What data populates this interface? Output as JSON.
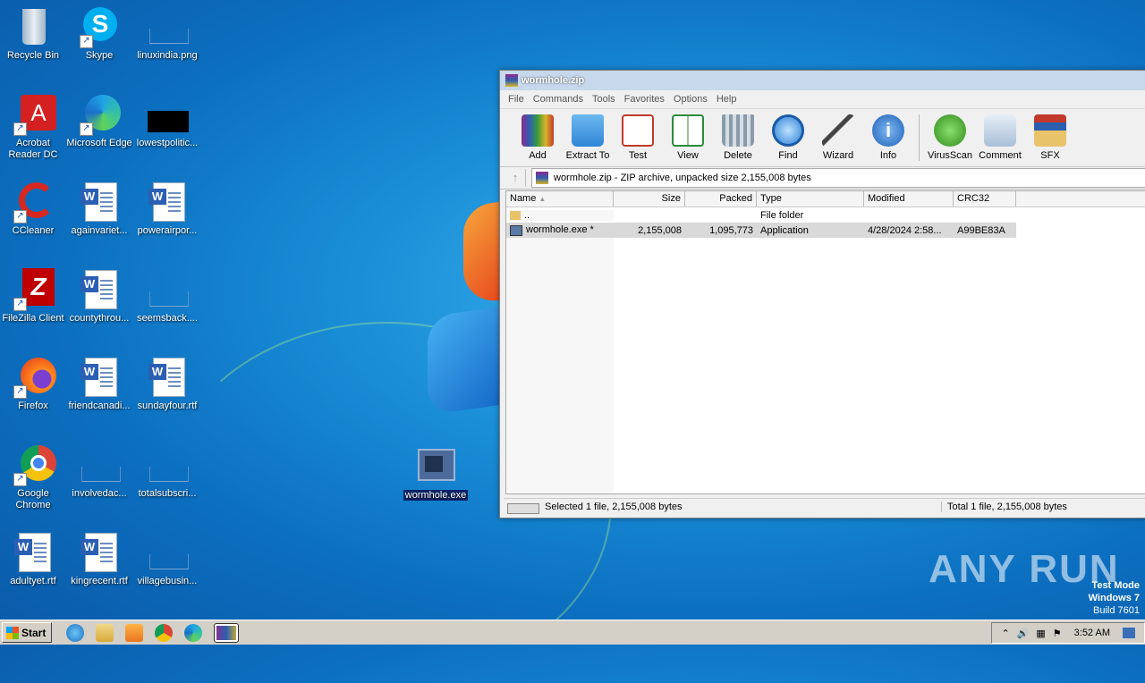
{
  "desktop": {
    "icons": [
      {
        "label": "Recycle Bin",
        "icon": "recycle-bin-icon"
      },
      {
        "label": "Skype",
        "icon": "skype-icon"
      },
      {
        "label": "linuxindia.png",
        "icon": "image-file-icon"
      },
      {
        "label": "Acrobat Reader DC",
        "icon": "acrobat-icon"
      },
      {
        "label": "Microsoft Edge",
        "icon": "edge-icon"
      },
      {
        "label": "lowestpolitic...",
        "icon": "image-file-icon"
      },
      {
        "label": "CCleaner",
        "icon": "ccleaner-icon"
      },
      {
        "label": "againvariet...",
        "icon": "word-doc-icon"
      },
      {
        "label": "powerairpor...",
        "icon": "word-doc-icon"
      },
      {
        "label": "FileZilla Client",
        "icon": "filezilla-icon"
      },
      {
        "label": "countythrou...",
        "icon": "word-doc-icon"
      },
      {
        "label": "seemsback....",
        "icon": "blank-file-icon"
      },
      {
        "label": "Firefox",
        "icon": "firefox-icon"
      },
      {
        "label": "friendcanadi...",
        "icon": "word-doc-icon"
      },
      {
        "label": "sundayfour.rtf",
        "icon": "word-doc-icon"
      },
      {
        "label": "Google Chrome",
        "icon": "chrome-icon"
      },
      {
        "label": "involvedac...",
        "icon": "blank-file-icon"
      },
      {
        "label": "totalsubscri...",
        "icon": "blank-file-icon"
      },
      {
        "label": "adultyet.rtf",
        "icon": "word-doc-icon"
      },
      {
        "label": "kingrecent.rtf",
        "icon": "word-doc-icon"
      },
      {
        "label": "villagebusin...",
        "icon": "blank-file-icon"
      },
      {
        "label": "wormhole.exe",
        "icon": "exe-file-icon"
      }
    ]
  },
  "window": {
    "title": "wormhole.zip",
    "menu": [
      "File",
      "Commands",
      "Tools",
      "Favorites",
      "Options",
      "Help"
    ],
    "toolbar": [
      "Add",
      "Extract To",
      "Test",
      "View",
      "Delete",
      "Find",
      "Wizard",
      "Info",
      "VirusScan",
      "Comment",
      "SFX"
    ],
    "address": "wormhole.zip - ZIP archive, unpacked size 2,155,008 bytes",
    "columns": [
      "Name",
      "Size",
      "Packed",
      "Type",
      "Modified",
      "CRC32"
    ],
    "rows": [
      {
        "name": "..",
        "size": "",
        "packed": "",
        "type": "File folder",
        "modified": "",
        "crc": ""
      },
      {
        "name": "wormhole.exe *",
        "size": "2,155,008",
        "packed": "1,095,773",
        "type": "Application",
        "modified": "4/28/2024 2:58...",
        "crc": "A99BE83A"
      }
    ],
    "status_left": "Selected 1 file, 2,155,008 bytes",
    "status_right": "Total 1 file, 2,155,008 bytes"
  },
  "watermark": {
    "text": "ANY RUN",
    "line1": "Test Mode",
    "line2": "Windows 7",
    "line3": "Build 7601"
  },
  "taskbar": {
    "start": "Start",
    "time": "3:52 AM"
  }
}
